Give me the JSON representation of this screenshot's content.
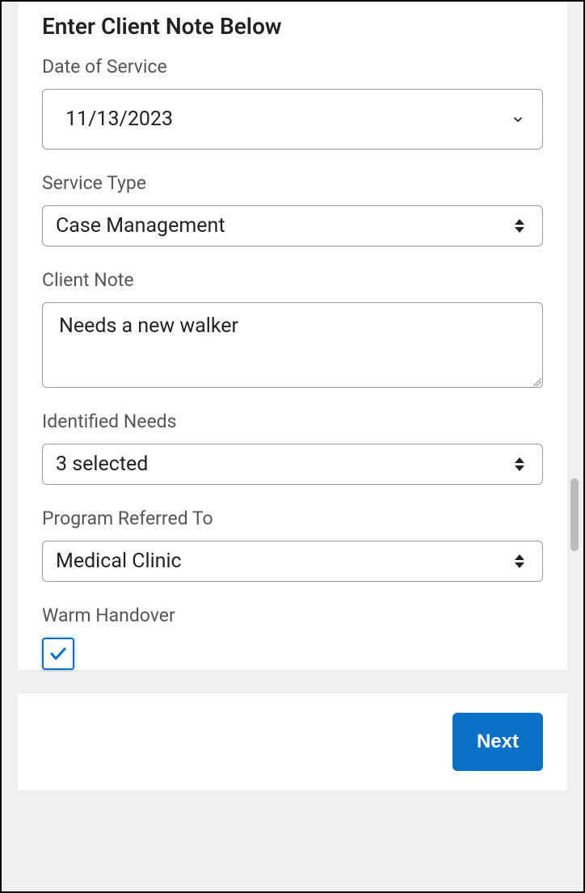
{
  "heading": "Enter Client Note Below",
  "fields": {
    "date_of_service": {
      "label": "Date of Service",
      "value": "11/13/2023"
    },
    "service_type": {
      "label": "Service Type",
      "value": "Case Management"
    },
    "client_note": {
      "label": "Client Note",
      "value": "Needs a new walker"
    },
    "identified_needs": {
      "label": "Identified Needs",
      "value": "3 selected"
    },
    "program_referred_to": {
      "label": "Program Referred To",
      "value": "Medical Clinic"
    },
    "warm_handover": {
      "label": "Warm Handover",
      "checked": true
    }
  },
  "footer": {
    "next_label": "Next"
  },
  "colors": {
    "primary": "#0a72c6"
  }
}
